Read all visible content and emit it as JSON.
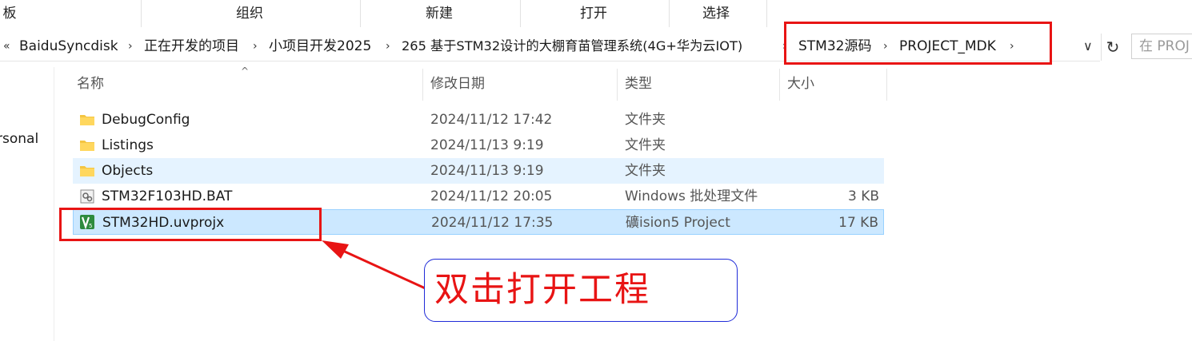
{
  "ribbon": {
    "groups": [
      "板",
      "组织",
      "新建",
      "打开",
      "选择"
    ]
  },
  "address_bar": {
    "overflow": "«",
    "crumbs": [
      "BaiduSyncdisk",
      "正在开发的项目",
      "小项目开发2025",
      "265 基于STM32设计的大棚育苗管理系统(4G+华为云IOT)",
      "STM32源码",
      "PROJECT_MDK"
    ],
    "dropdown_icon": "chevron-down-icon",
    "refresh_icon": "refresh-icon",
    "search_placeholder": "在 PROJ"
  },
  "nav_pane": {
    "partial_item": "rsonal"
  },
  "columns": {
    "name": "名称",
    "date": "修改日期",
    "type": "类型",
    "size": "大小",
    "sort_indicator": "^"
  },
  "files": [
    {
      "name": "DebugConfig",
      "date": "2024/11/12 17:42",
      "type": "文件夹",
      "size": "",
      "icon": "folder-icon",
      "state": "normal"
    },
    {
      "name": "Listings",
      "date": "2024/11/13 9:19",
      "type": "文件夹",
      "size": "",
      "icon": "folder-icon",
      "state": "normal"
    },
    {
      "name": "Objects",
      "date": "2024/11/13 9:19",
      "type": "文件夹",
      "size": "",
      "icon": "folder-icon",
      "state": "hover"
    },
    {
      "name": "STM32F103HD.BAT",
      "date": "2024/11/12 20:05",
      "type": "Windows 批处理文件",
      "size": "3 KB",
      "icon": "batch-file-icon",
      "state": "normal"
    },
    {
      "name": "STM32HD.uvprojx",
      "date": "2024/11/12 17:35",
      "type": "礦ision5 Project",
      "size": "17 KB",
      "icon": "keil-project-icon",
      "state": "selected"
    }
  ],
  "annotation": {
    "callout_text": "双击打开工程",
    "color": "#e81414",
    "callout_border": "#1f2bd8"
  },
  "colors": {
    "hover_row": "#e5f3ff",
    "selected_row": "#cce8ff",
    "selected_border": "#99d1ff"
  }
}
